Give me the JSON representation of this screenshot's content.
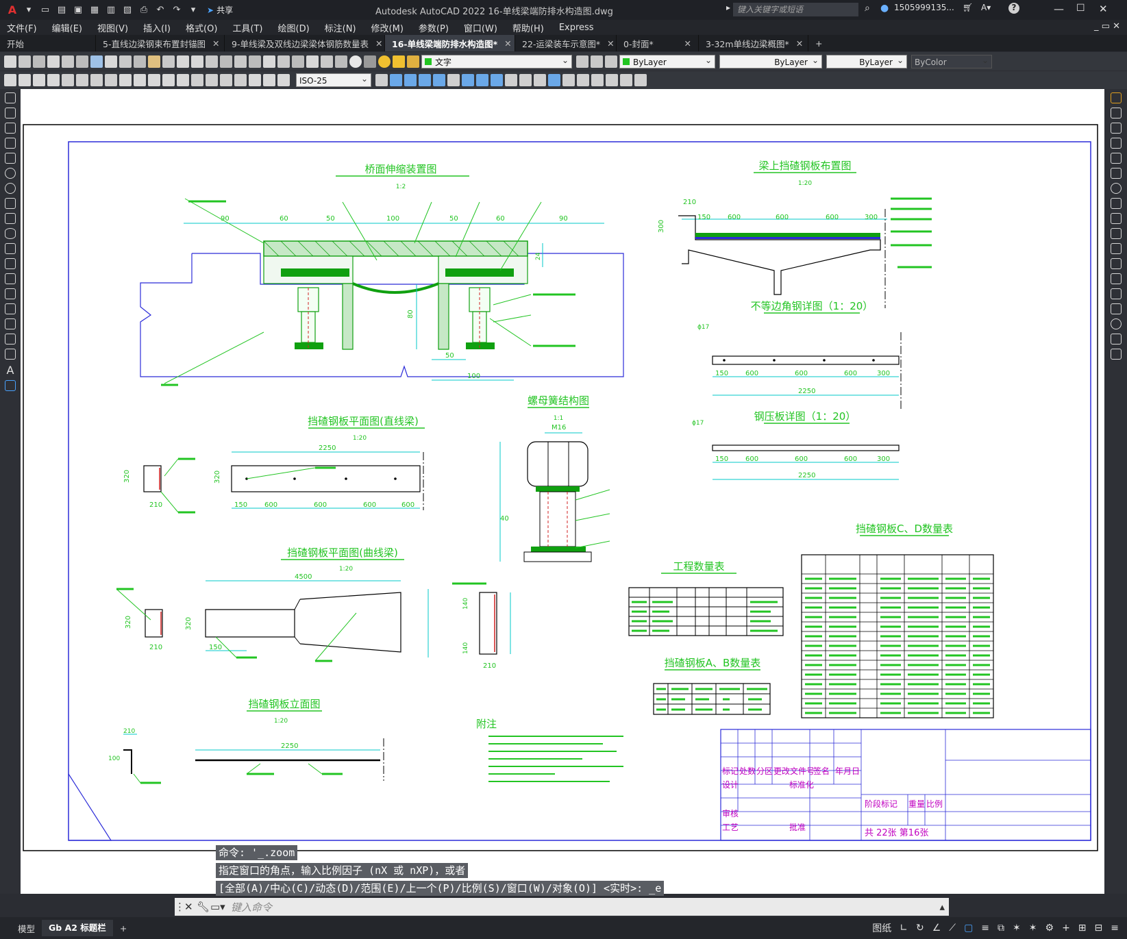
{
  "app": {
    "title": "Autodesk AutoCAD 2022    16-单线梁端防排水构造图.dwg",
    "search_placeholder": "键入关键字或短语",
    "user": "1505999135...",
    "share": "共享"
  },
  "menu": [
    "文件(F)",
    "编辑(E)",
    "视图(V)",
    "插入(I)",
    "格式(O)",
    "工具(T)",
    "绘图(D)",
    "标注(N)",
    "修改(M)",
    "参数(P)",
    "窗口(W)",
    "帮助(H)",
    "Express"
  ],
  "tabs": [
    {
      "label": "开始",
      "active": false
    },
    {
      "label": "5-直线边梁钢束布置封锚图",
      "active": false
    },
    {
      "label": "9-单线梁及双线边梁梁体钢筋数量表",
      "active": false
    },
    {
      "label": "16-单线梁端防排水构造图*",
      "active": true
    },
    {
      "label": "22-运梁装车示意图*",
      "active": false
    },
    {
      "label": "0-封面*",
      "active": false
    },
    {
      "label": "3-32m单线边梁概图*",
      "active": false
    }
  ],
  "toolbar": {
    "text_style": "文字",
    "dim_style": "ISO-25",
    "layer": "ByLayer",
    "linetype": "ByLayer",
    "lineweight": "ByLayer",
    "color": "ByColor"
  },
  "drawing": {
    "titles": {
      "t1": "桥面伸缩装置图",
      "t1s": "1:2",
      "t2": "梁上挡碴钢板布置图",
      "t2s": "1:20",
      "t3": "不等边角钢详图（1：20）",
      "t4": "钢压板详图（1：20）",
      "t5": "螺母簧结构图",
      "t5s": "1:1",
      "t6": "挡碴钢板平面图(直线梁)",
      "t6s": "1:20",
      "t7": "挡碴钢板平面图(曲线梁)",
      "t7s": "1:20",
      "t8": "挡碴钢板立面图",
      "t8s": "1:20",
      "t9": "工程数量表",
      "t10": "挡碴钢板A、B数量表",
      "t11": "挡碴钢板C、D数量表",
      "notes": "附注"
    },
    "dims": {
      "d90": "90",
      "d60": "60",
      "d50": "50",
      "d100": "100",
      "d80": "80",
      "d24": "24",
      "d210": "210",
      "d150": "150",
      "d600": "600",
      "d300": "300",
      "d2250": "2250",
      "d320": "320",
      "d140": "140",
      "d4500": "4500",
      "d17": "ϕ17",
      "dM16": "M16",
      "d40": "40"
    },
    "title_block": {
      "r1": [
        "标记",
        "处数",
        "分区",
        "更改文件号",
        "签名",
        "年月日"
      ],
      "r2": [
        "设计",
        "标准化"
      ],
      "r3": [
        "审核"
      ],
      "r4": [
        "工艺",
        "批准"
      ],
      "stage": "阶段标记",
      "weight": "重量",
      "scale": "比例",
      "sheet": "共 22张  第16张"
    }
  },
  "command": {
    "line1": "命令: '_.zoom",
    "line2": "指定窗口的角点，输入比例因子 (nX 或 nXP)，或者",
    "line3": "[全部(A)/中心(C)/动态(D)/范围(E)/上一个(P)/比例(S)/窗口(W)/对象(O)] <实时>: _e",
    "input_placeholder": "键入命令"
  },
  "status": {
    "layout_tabs": [
      "模型",
      "Gb A2 标题栏"
    ],
    "mode": "图纸"
  },
  "colors": {
    "title_green": "#22c422",
    "dim_cyan": "#00c8c8",
    "frame_blue": "#2b2bd8",
    "hatch_green": "#10a010",
    "title_block_magenta": "#c000c0"
  }
}
